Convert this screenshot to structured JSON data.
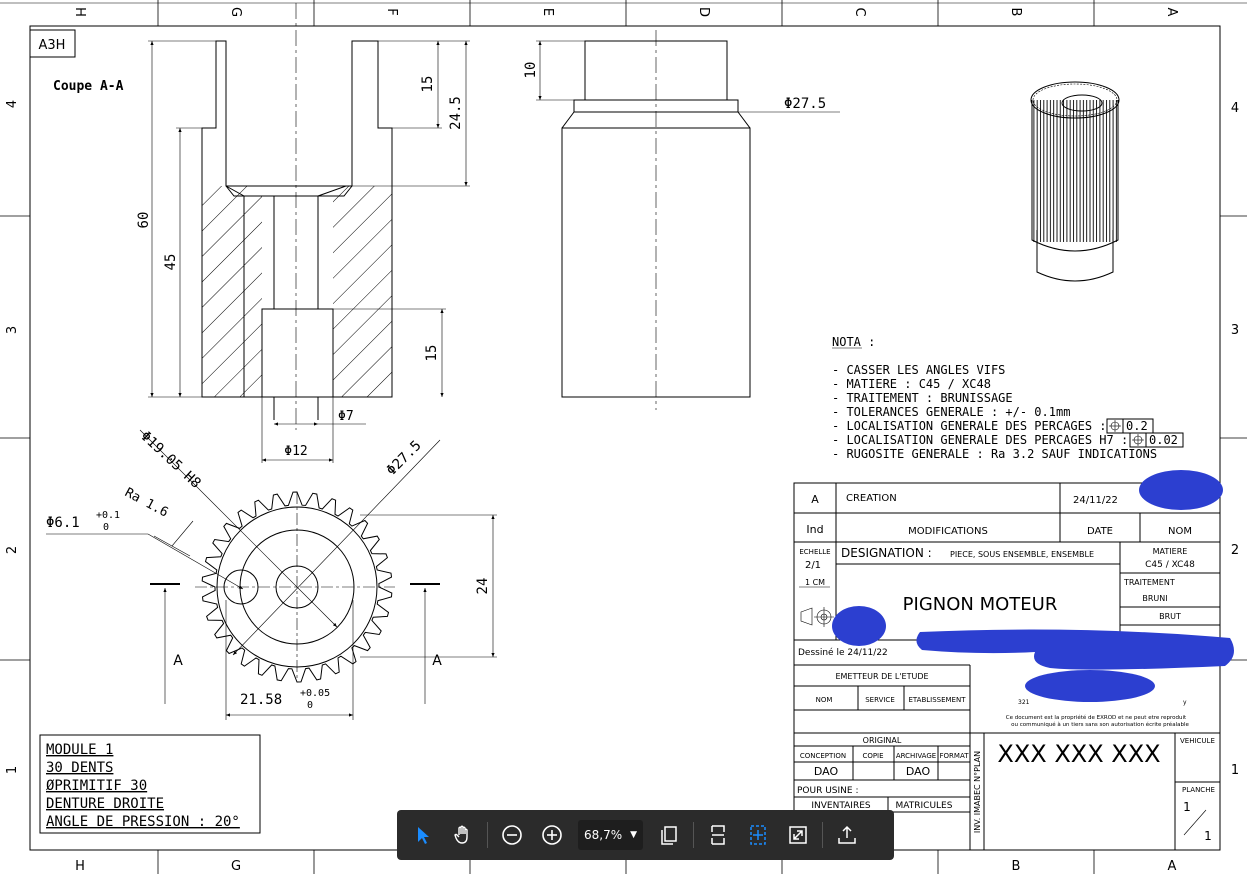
{
  "sheet": {
    "format": "A3H",
    "col_labels": [
      "H",
      "G",
      "F",
      "E",
      "D",
      "C",
      "B",
      "A"
    ],
    "row_labels": [
      "4",
      "3",
      "2",
      "1"
    ]
  },
  "section": {
    "title": "Coupe A-A",
    "dims": {
      "d60": "60",
      "d45": "45",
      "d15a": "15",
      "d245": "24.5",
      "d15b": "15",
      "phi7": "Φ7",
      "phi12": "Φ12"
    }
  },
  "side_view": {
    "d10": "10",
    "phi275": "Φ27.5"
  },
  "front_view": {
    "phi1905": "Φ19.05 H8",
    "phi275": "Φ27.5",
    "ra": "Ra 1.6",
    "phi61": "Φ6.1",
    "phi61_up": "+0.1",
    "phi61_low": "0",
    "d24": "24",
    "d2158": "21.58",
    "d2158_up": "+0.05",
    "d2158_low": "0",
    "cut_a": "A"
  },
  "gear_spec": [
    "MODULE 1",
    "30 DENTS",
    "ØPRIMITIF 30",
    "DENTURE DROITE",
    "ANGLE DE PRESSION : 20°"
  ],
  "nota": {
    "title": "NOTA :",
    "lines": [
      "- CASSER LES ANGLES VIFS",
      "- MATIERE : C45  / XC48",
      "- TRAITEMENT : BRUNISSAGE",
      "- TOLERANCES GENERALE : +/- 0.1mm",
      "- LOCALISATION GENERALE DES PERCAGES :",
      "- LOCALISATION GENERALE DES PERCAGES H7 :",
      "- RUGOSITE GENERALE : Ra 3.2 SAUF INDICATIONS"
    ],
    "tol1": "0.2",
    "tol2": "0.02"
  },
  "title_block": {
    "rev_ind": "A",
    "rev_desc": "CREATION",
    "rev_date": "24/11/22",
    "h_ind": "Ind",
    "h_mod": "MODIFICATIONS",
    "h_date": "DATE",
    "h_nom": "NOM",
    "echelle": "ECHELLE",
    "scale": "2/1",
    "cm": "1 CM",
    "designation": "DESIGNATION :",
    "designation_sub": "PIECE, SOUS ENSEMBLE, ENSEMBLE",
    "matiere": "MATIERE",
    "matiere_val": "C45 / XC48",
    "traitement": "TRAITEMENT",
    "bruni": "BRUNI",
    "brut": "BRUT",
    "part_name": "PIGNON MOTEUR",
    "dessine": "Dessiné le 24/11/22",
    "emetteur": "EMETTEUR DE L'ETUDE",
    "nom": "NOM",
    "service": "SERVICE",
    "etablissement": "ETABLISSEMENT",
    "addr": "321",
    "addr_suffix": "y",
    "legal1": "Ce document est la propriété de EXROD et ne peut etre reproduit",
    "legal2": "ou communiqué à un tiers sans son autorisation écrite préalable",
    "original": "ORIGINAL",
    "conception": "CONCEPTION",
    "copie": "COPIE",
    "archivage": "ARCHIVAGE",
    "format": "FORMAT",
    "dao1": "DAO",
    "dao2": "DAO",
    "pour_usine": "POUR USINE :",
    "inventaires": "INVENTAIRES",
    "matricules": "MATRICULES",
    "inv": "INV. IMABEC N°PLAN",
    "plan_no": "XXX XXX XXX",
    "vehicule": "VEHICULE",
    "planche": "PLANCHE",
    "planche_num": "1",
    "planche_den": "1"
  },
  "toolbar": {
    "zoom": "68,7%"
  }
}
